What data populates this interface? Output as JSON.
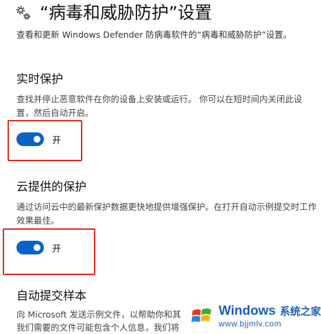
{
  "header": {
    "icon": "gear-icon",
    "title": "“病毒和威胁防护”设置",
    "subtitle": "查看和更新 Windows Defender 防病毒软件的“病毒和威胁防护”设置。"
  },
  "sections": [
    {
      "title": "实时保护",
      "description": "查找并停止恶意软件在你的设备上安装或运行。 你可以在短时间内关闭此设置，然后自动开启。",
      "toggle_state": "开",
      "toggle_on": true
    },
    {
      "title": "云提供的保护",
      "description": "通过访问云中的最新保护数据更快地提供增强保护。在打开自动示例提交时工作效果最佳。",
      "toggle_state": "开",
      "toggle_on": true
    },
    {
      "title": "自动提交样本",
      "description_line1": "向 Microsoft 发送示例文件，以帮助你和其",
      "description_line2": "我们需要的文件可能包含个人信息，我们将"
    }
  ],
  "watermark": {
    "brand": "Windows",
    "brand_cn": "系统之家",
    "url": "www.bjjmlv.com"
  },
  "colors": {
    "toggle_on": "#0a63c9",
    "highlight": "#e0281f",
    "watermark_text": "#1e5fb4"
  }
}
